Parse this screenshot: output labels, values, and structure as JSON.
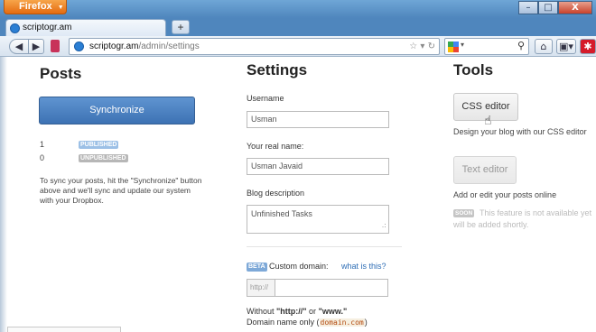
{
  "browser": {
    "app_button": "Firefox",
    "tab_title": "scriptogr.am",
    "new_tab": "+",
    "url_domain": "scriptogr.am",
    "url_path": "/admin/settings",
    "window_controls": [
      "–",
      "□",
      "X"
    ]
  },
  "posts": {
    "title": "Posts",
    "sync_button": "Synchronize",
    "published_count": "1",
    "published_label": "PUBLISHED",
    "unpublished_count": "0",
    "unpublished_label": "UNPUBLISHED",
    "help_text": "To sync your posts, hit the \"Synchronize\" button above and we'll sync and update our system with your Dropbox."
  },
  "settings": {
    "title": "Settings",
    "username_label": "Username",
    "username_value": "Usman",
    "realname_label": "Your real name:",
    "realname_value": "Usman Javaid",
    "description_label": "Blog description",
    "description_value": "Unfinished Tasks",
    "beta_badge": "BETA",
    "custom_domain_label": "Custom domain:",
    "what_is_this": "what is this?",
    "http_prefix": "http://",
    "hint_prefix": "Without ",
    "hint_http": "\"http://\"",
    "hint_or": " or ",
    "hint_www": "\"www.\"",
    "hint2_prefix": "Domain name only (",
    "hint2_code": "domain.com",
    "hint2_suffix": ")"
  },
  "tools": {
    "title": "Tools",
    "css_button": "CSS editor",
    "css_desc": "Design your blog with our CSS editor",
    "text_button": "Text editor",
    "text_desc": "Add or edit your posts online",
    "soon_badge": "SOON",
    "soon_text_1": "This feature is not available yet",
    "soon_text_2": "will be added shortly."
  }
}
